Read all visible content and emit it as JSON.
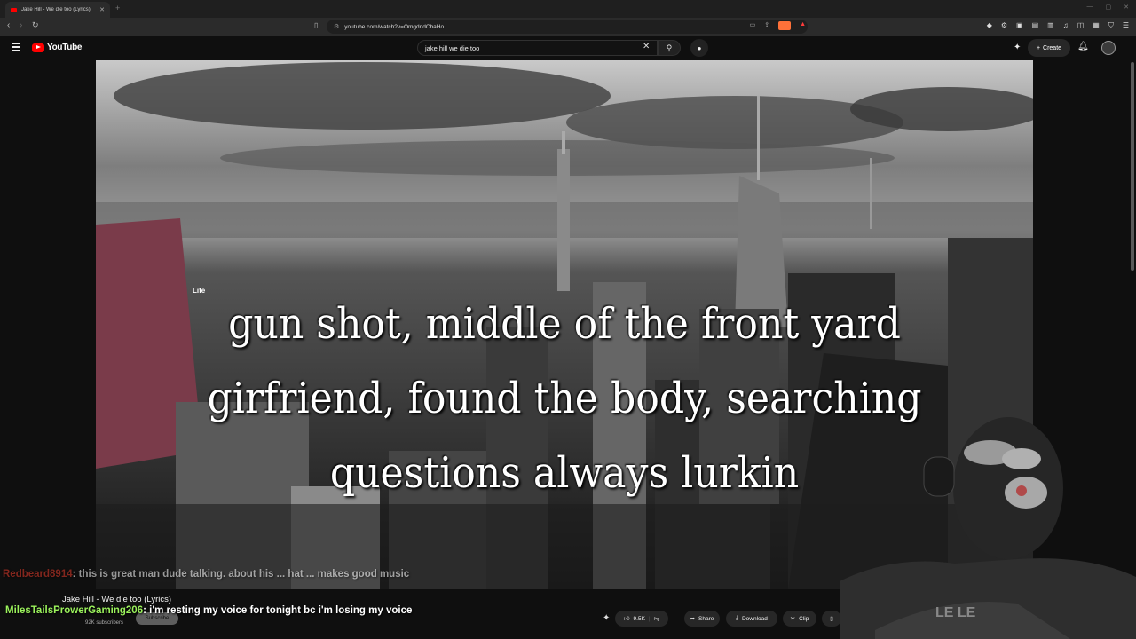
{
  "browser": {
    "tab_title": "Jake Hill - We die too (Lyrics)",
    "tab_close": "✕",
    "new_tab": "+",
    "url": "youtube.com/watch?v=OmgdndCbaHo",
    "window_controls": [
      "—",
      "▢",
      "✕"
    ]
  },
  "youtube": {
    "logo_text": "YouTube",
    "search_query": "jake hill we die too",
    "create_label": "Create"
  },
  "video": {
    "lyrics": [
      "gun shot, middle of the front yard",
      "girfriend, found the body, searching",
      "questions always lurkin"
    ],
    "building_sign": "Life"
  },
  "info": {
    "title": "Jake Hill - We die too (Lyrics)",
    "subscribers": "92K subscribers",
    "subscribe_label": "Subscribe",
    "likes": "9.5K",
    "share_label": "Share",
    "download_label": "Download",
    "clip_label": "Clip"
  },
  "chat": [
    {
      "user": "Redbeard8914",
      "message": ": this is great man dude talking. about his ... hat ... makes good music"
    },
    {
      "user": "MilesTailsProwerGaming206",
      "message": ": i'm resting my voice for tonight bc i'm losing my voice"
    }
  ]
}
